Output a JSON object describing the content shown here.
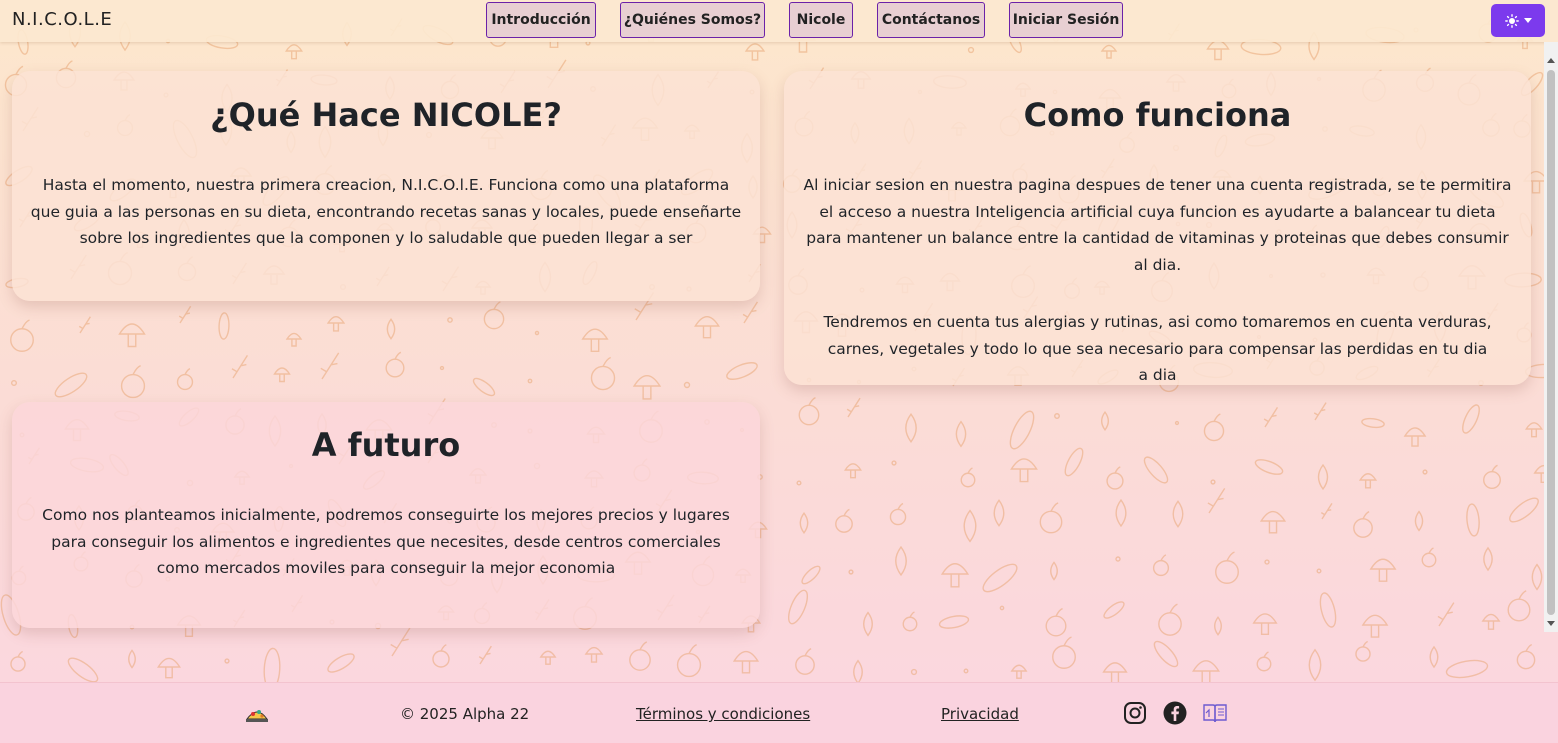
{
  "navbar": {
    "brand": "N.I.C.O.L.E",
    "links": [
      "Introducción",
      "¿Quiénes Somos?",
      "Nicole",
      "Contáctanos",
      "Iniciar Sesión"
    ],
    "theme_toggle_icon": "sun-icon",
    "accent_color": "#7c3aed"
  },
  "cards": {
    "what": {
      "title": "¿Qué Hace NICOLE?",
      "paragraphs": [
        "Hasta el momento, nuestra primera creacion, N.I.C.O.l.E. Funciona como una plataforma que guia a las personas en su dieta, encontrando recetas sanas y locales, puede enseñarte sobre los ingredientes que la componen y lo saludable que pueden llegar a ser"
      ]
    },
    "how": {
      "title": "Como funciona",
      "paragraphs": [
        "Al iniciar sesion en nuestra pagina despues de tener una cuenta registrada, se te permitira el acceso a nuestra Inteligencia artificial cuya funcion es ayudarte a balancear tu dieta para mantener un balance entre la cantidad de vitaminas y proteinas que debes consumir al dia.",
        "Tendremos en cuenta tus alergias y rutinas, asi como tomaremos en cuenta verduras, carnes, vegetales y todo lo que sea necesario para compensar las perdidas en tu dia a dia"
      ]
    },
    "future": {
      "title": "A futuro",
      "paragraphs": [
        "Como nos planteamos inicialmente, podremos conseguirte los mejores precios y lugares para conseguir los alimentos e ingredientes que necesites, desde centros comerciales como mercados moviles para conseguir la mejor economia"
      ]
    }
  },
  "footer": {
    "logo_icon": "food-logo-icon",
    "copyright": "© 2025 Alpha 22",
    "terms": "Términos y condiciones",
    "privacy": "Privacidad",
    "social_icons": [
      "instagram-icon",
      "facebook-icon",
      "book-icon"
    ]
  }
}
